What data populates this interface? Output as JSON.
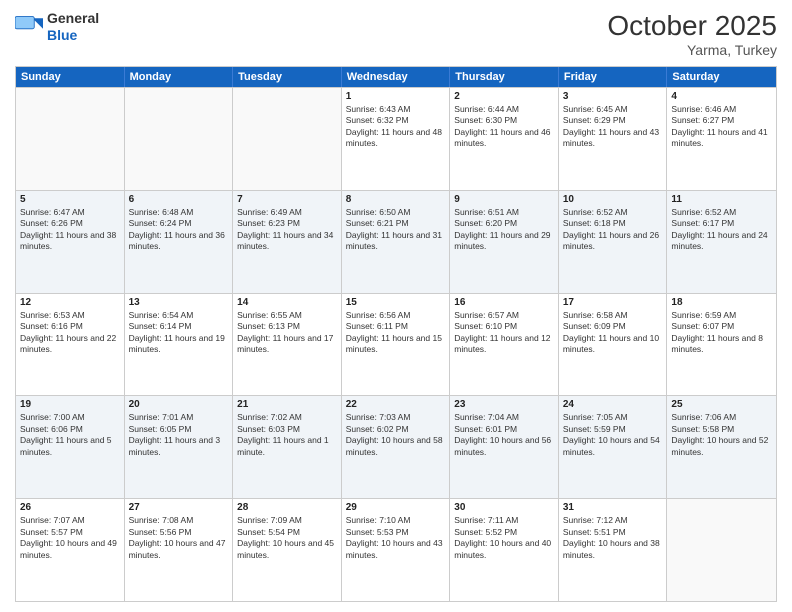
{
  "header": {
    "logo_general": "General",
    "logo_blue": "Blue",
    "month": "October 2025",
    "location": "Yarma, Turkey"
  },
  "days_of_week": [
    "Sunday",
    "Monday",
    "Tuesday",
    "Wednesday",
    "Thursday",
    "Friday",
    "Saturday"
  ],
  "rows": [
    [
      {
        "day": "",
        "empty": true
      },
      {
        "day": "",
        "empty": true
      },
      {
        "day": "",
        "empty": true
      },
      {
        "day": "1",
        "sunrise": "6:43 AM",
        "sunset": "6:32 PM",
        "daylight": "11 hours and 48 minutes."
      },
      {
        "day": "2",
        "sunrise": "6:44 AM",
        "sunset": "6:30 PM",
        "daylight": "11 hours and 46 minutes."
      },
      {
        "day": "3",
        "sunrise": "6:45 AM",
        "sunset": "6:29 PM",
        "daylight": "11 hours and 43 minutes."
      },
      {
        "day": "4",
        "sunrise": "6:46 AM",
        "sunset": "6:27 PM",
        "daylight": "11 hours and 41 minutes."
      }
    ],
    [
      {
        "day": "5",
        "sunrise": "6:47 AM",
        "sunset": "6:26 PM",
        "daylight": "11 hours and 38 minutes."
      },
      {
        "day": "6",
        "sunrise": "6:48 AM",
        "sunset": "6:24 PM",
        "daylight": "11 hours and 36 minutes."
      },
      {
        "day": "7",
        "sunrise": "6:49 AM",
        "sunset": "6:23 PM",
        "daylight": "11 hours and 34 minutes."
      },
      {
        "day": "8",
        "sunrise": "6:50 AM",
        "sunset": "6:21 PM",
        "daylight": "11 hours and 31 minutes."
      },
      {
        "day": "9",
        "sunrise": "6:51 AM",
        "sunset": "6:20 PM",
        "daylight": "11 hours and 29 minutes."
      },
      {
        "day": "10",
        "sunrise": "6:52 AM",
        "sunset": "6:18 PM",
        "daylight": "11 hours and 26 minutes."
      },
      {
        "day": "11",
        "sunrise": "6:52 AM",
        "sunset": "6:17 PM",
        "daylight": "11 hours and 24 minutes."
      }
    ],
    [
      {
        "day": "12",
        "sunrise": "6:53 AM",
        "sunset": "6:16 PM",
        "daylight": "11 hours and 22 minutes."
      },
      {
        "day": "13",
        "sunrise": "6:54 AM",
        "sunset": "6:14 PM",
        "daylight": "11 hours and 19 minutes."
      },
      {
        "day": "14",
        "sunrise": "6:55 AM",
        "sunset": "6:13 PM",
        "daylight": "11 hours and 17 minutes."
      },
      {
        "day": "15",
        "sunrise": "6:56 AM",
        "sunset": "6:11 PM",
        "daylight": "11 hours and 15 minutes."
      },
      {
        "day": "16",
        "sunrise": "6:57 AM",
        "sunset": "6:10 PM",
        "daylight": "11 hours and 12 minutes."
      },
      {
        "day": "17",
        "sunrise": "6:58 AM",
        "sunset": "6:09 PM",
        "daylight": "11 hours and 10 minutes."
      },
      {
        "day": "18",
        "sunrise": "6:59 AM",
        "sunset": "6:07 PM",
        "daylight": "11 hours and 8 minutes."
      }
    ],
    [
      {
        "day": "19",
        "sunrise": "7:00 AM",
        "sunset": "6:06 PM",
        "daylight": "11 hours and 5 minutes."
      },
      {
        "day": "20",
        "sunrise": "7:01 AM",
        "sunset": "6:05 PM",
        "daylight": "11 hours and 3 minutes."
      },
      {
        "day": "21",
        "sunrise": "7:02 AM",
        "sunset": "6:03 PM",
        "daylight": "11 hours and 1 minute."
      },
      {
        "day": "22",
        "sunrise": "7:03 AM",
        "sunset": "6:02 PM",
        "daylight": "10 hours and 58 minutes."
      },
      {
        "day": "23",
        "sunrise": "7:04 AM",
        "sunset": "6:01 PM",
        "daylight": "10 hours and 56 minutes."
      },
      {
        "day": "24",
        "sunrise": "7:05 AM",
        "sunset": "5:59 PM",
        "daylight": "10 hours and 54 minutes."
      },
      {
        "day": "25",
        "sunrise": "7:06 AM",
        "sunset": "5:58 PM",
        "daylight": "10 hours and 52 minutes."
      }
    ],
    [
      {
        "day": "26",
        "sunrise": "7:07 AM",
        "sunset": "5:57 PM",
        "daylight": "10 hours and 49 minutes."
      },
      {
        "day": "27",
        "sunrise": "7:08 AM",
        "sunset": "5:56 PM",
        "daylight": "10 hours and 47 minutes."
      },
      {
        "day": "28",
        "sunrise": "7:09 AM",
        "sunset": "5:54 PM",
        "daylight": "10 hours and 45 minutes."
      },
      {
        "day": "29",
        "sunrise": "7:10 AM",
        "sunset": "5:53 PM",
        "daylight": "10 hours and 43 minutes."
      },
      {
        "day": "30",
        "sunrise": "7:11 AM",
        "sunset": "5:52 PM",
        "daylight": "10 hours and 40 minutes."
      },
      {
        "day": "31",
        "sunrise": "7:12 AM",
        "sunset": "5:51 PM",
        "daylight": "10 hours and 38 minutes."
      },
      {
        "day": "",
        "empty": true
      }
    ]
  ]
}
